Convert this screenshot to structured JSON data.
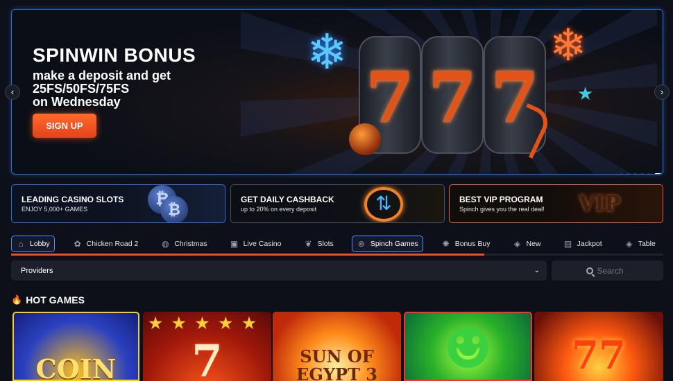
{
  "hero": {
    "title": "SPINWIN BONUS",
    "subtitle_line1": "make a deposit and get",
    "subtitle_line2": "25FS/50FS/75FS",
    "subtitle_line3": "on Wednesday",
    "cta_label": "SIGN UP",
    "prev_label": "‹",
    "next_label": "›",
    "slides_total": 6,
    "active_slide": 6
  },
  "promos": [
    {
      "title": "LEADING CASINO SLOTS",
      "subtitle": "ENJOY 5,000+ GAMES"
    },
    {
      "title": "GET DAILY CASHBACK",
      "subtitle": "up to 20% on every deposit"
    },
    {
      "title": "BEST VIP PROGRAM",
      "subtitle": "Spinch gives you the real deal!"
    }
  ],
  "nav": {
    "items": [
      {
        "label": "Lobby",
        "icon": "home-icon"
      },
      {
        "label": "Chicken Road 2",
        "icon": "chicken-icon"
      },
      {
        "label": "Christmas",
        "icon": "ornament-icon"
      },
      {
        "label": "Live Casino",
        "icon": "person-icon"
      },
      {
        "label": "Slots",
        "icon": "cherry-icon"
      },
      {
        "label": "Spinch Games",
        "icon": "spinch-logo-icon"
      },
      {
        "label": "Bonus Buy",
        "icon": "gear-icon"
      },
      {
        "label": "New",
        "icon": "badge-icon"
      },
      {
        "label": "Jackpot",
        "icon": "chest-icon"
      },
      {
        "label": "Table",
        "icon": "cards-icon"
      }
    ],
    "progress_percent": 72.5
  },
  "filters": {
    "providers_label": "Providers",
    "search_placeholder": "Search"
  },
  "hot_games": {
    "title": "HOT GAMES",
    "games": [
      {
        "art_text": "COIN"
      },
      {
        "art_text": "7"
      },
      {
        "art_text": "SUN OF EGYPT 3"
      },
      {
        "art_text": ""
      },
      {
        "art_text": "77"
      }
    ]
  },
  "colors": {
    "accent_blue": "#2f6fd8",
    "accent_orange": "#e2532a",
    "background": "#0d1018",
    "panel": "#1c2029"
  }
}
